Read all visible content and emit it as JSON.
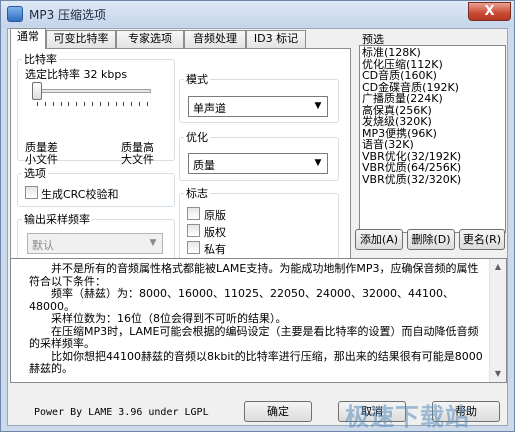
{
  "window": {
    "title": "MP3 压缩选项",
    "close_label": "X"
  },
  "tabs": [
    {
      "label": "通常"
    },
    {
      "label": "可变比特率"
    },
    {
      "label": "专家选项"
    },
    {
      "label": "音频处理"
    },
    {
      "label": "ID3 标记"
    }
  ],
  "bitrate": {
    "group_label": "比特率",
    "selected_label": "选定比特率 32 kbps",
    "slider_value_kbps": 32,
    "low_quality": "质量差",
    "small_file": "小文件",
    "high_quality": "质量高",
    "large_file": "大文件"
  },
  "mode": {
    "group_label": "模式",
    "selected": "单声道"
  },
  "optimize": {
    "group_label": "优化",
    "selected": "质量"
  },
  "options": {
    "group_label": "选项",
    "crc_label": "生成CRC校验和",
    "crc_checked": false
  },
  "flags": {
    "group_label": "标志",
    "original_label": "原版",
    "original_checked": false,
    "copyright_label": "版权",
    "copyright_checked": false,
    "private_label": "私有",
    "private_checked": false
  },
  "samplerate": {
    "group_label": "输出采样频率",
    "selected": "默认"
  },
  "presets": {
    "group_label": "预选",
    "items": [
      "标准(128K)",
      "优化压缩(112K)",
      "CD音质(160K)",
      "CD金碟音质(192K)",
      "广播质量(224K)",
      "高保真(256K)",
      "发烧级(320K)",
      "MP3便携(96K)",
      "语音(32K)",
      "VBR优化(32/192K)",
      "VBR优质(64/256K)",
      "VBR优质(32/320K)"
    ],
    "add_label": "添加(A)",
    "delete_label": "删除(D)",
    "rename_label": "更名(R)"
  },
  "info": {
    "paragraphs": [
      "并不是所有的音频属性格式都能被LAME支持。为能成功地制作MP3，应确保音频的属性符合以下条件：",
      "频率（赫兹）为：8000、16000、11025、22050、24000、32000、44100、48000。",
      "采样位数为：16位（8位会得到不可听的结果）。",
      "在压缩MP3时，LAME可能会根据的编码设定（主要是看比特率的设置）而自动降低音频的采样频率。",
      "比如你想把44100赫兹的音频以8kbit的比特率进行压缩，那出来的结果很有可能是8000赫兹的。"
    ]
  },
  "footer": {
    "powered_by": "Power By LAME 3.96 under LGPL",
    "ok_label": "确定",
    "cancel_label": "取消",
    "help_label": "帮助"
  },
  "watermark": {
    "text": "极速下载站"
  }
}
